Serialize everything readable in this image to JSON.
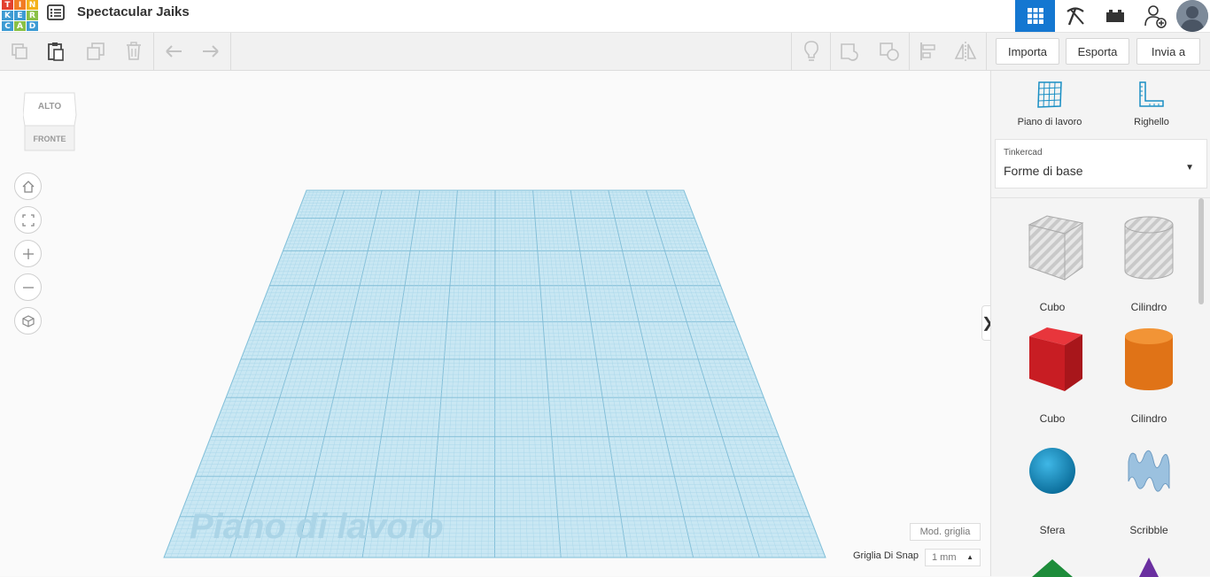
{
  "header": {
    "logo_letters": [
      "T",
      "I",
      "N",
      "K",
      "E",
      "R",
      "C",
      "A",
      "D"
    ],
    "logo_colors": [
      "#e2412f",
      "#f17c24",
      "#f3b21a",
      "#3d9bd3",
      "#3d9bd3",
      "#8ac046",
      "#3d9bd3",
      "#8ac046",
      "#3d9bd3"
    ],
    "doc_title": "Spectacular Jaiks",
    "menu_icon": "list-menu-icon",
    "right_icons": [
      "3d-view-icon",
      "pickaxe-icon",
      "brick-icon",
      "add-user-icon",
      "avatar"
    ],
    "accent": "#1477d1"
  },
  "toolbar": {
    "left_tools": [
      "copy-icon",
      "paste-icon",
      "duplicate-icon",
      "delete-icon",
      "undo-icon",
      "redo-icon"
    ],
    "right_tools": [
      "light-bulb-icon",
      "group-icon",
      "ungroup-icon",
      "align-icon",
      "mirror-icon"
    ],
    "import_label": "Importa",
    "export_label": "Esporta",
    "send_label": "Invia a"
  },
  "viewport": {
    "viewcube_top": "ALTO",
    "viewcube_front": "FRONTE",
    "nav_buttons": [
      "home-view-icon",
      "fit-view-icon",
      "zoom-in-icon",
      "zoom-out-icon",
      "perspective-icon"
    ],
    "workplane_label": "Piano di lavoro",
    "grid_mode_label": "Mod. griglia",
    "snap_label": "Griglia Di Snap",
    "snap_value": "1 mm",
    "collapse_glyph": "❯"
  },
  "panel": {
    "workplane_tool": "Piano di lavoro",
    "ruler_tool": "Righello",
    "library_provider": "Tinkercad",
    "library_name": "Forme di base",
    "shapes": [
      {
        "name": "Cubo",
        "kind": "hole-box"
      },
      {
        "name": "Cilindro",
        "kind": "hole-cylinder"
      },
      {
        "name": "Cubo",
        "kind": "box",
        "color": "#d92027"
      },
      {
        "name": "Cilindro",
        "kind": "cylinder",
        "color": "#e87c1e"
      },
      {
        "name": "Sfera",
        "kind": "sphere",
        "color": "#1a8fc4"
      },
      {
        "name": "Scribble",
        "kind": "scribble",
        "color": "#8fb6d6"
      }
    ]
  }
}
